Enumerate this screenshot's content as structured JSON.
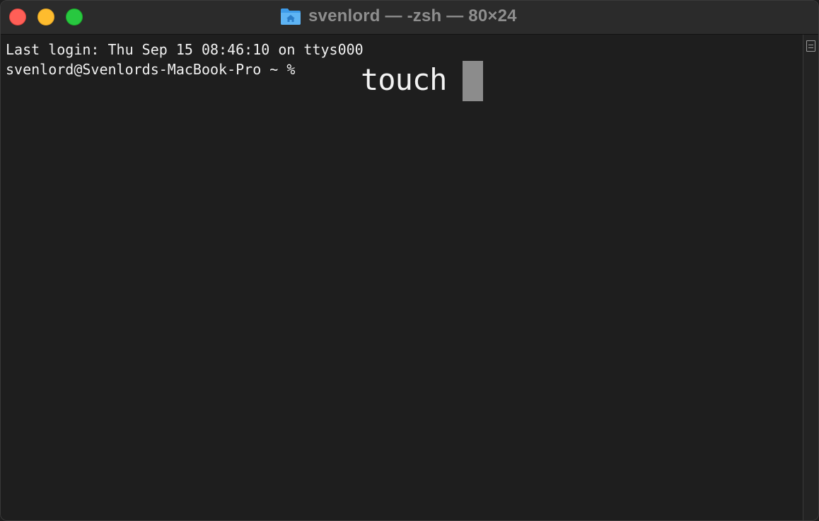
{
  "window": {
    "title": "svenlord — -zsh — 80×24",
    "title_icon": "home-folder-icon",
    "traffic_lights": {
      "close": "#ff5f57",
      "minimize": "#febc2e",
      "zoom": "#28c840"
    }
  },
  "terminal": {
    "last_login": "Last login: Thu Sep 15 08:46:10 on ttys000",
    "prompt": "svenlord@Svenlords-MacBook-Pro ~ %",
    "typed_command": "touch",
    "background": "#1e1e1e",
    "text_color": "#f0f0f0",
    "cursor_color": "#8c8c8c"
  },
  "scrollbar": {
    "icon": "scroll-marker-icon"
  }
}
